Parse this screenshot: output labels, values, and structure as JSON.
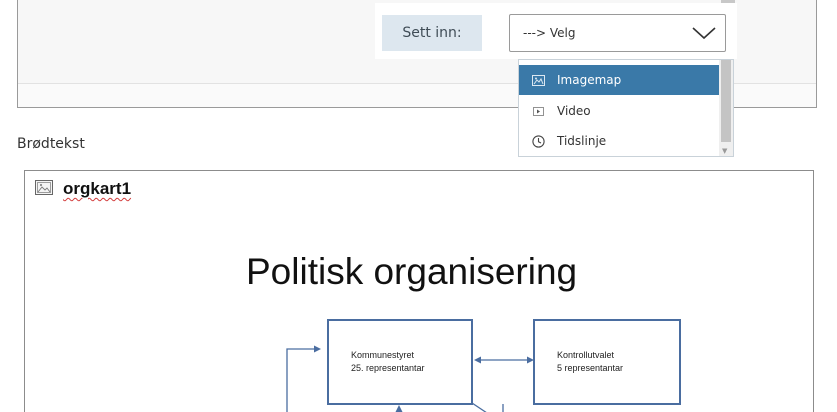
{
  "insert": {
    "label": "Sett inn:",
    "select_value": "---> Velg"
  },
  "dropdown": {
    "items": [
      {
        "label": "Imagemap",
        "icon": "image-icon",
        "selected": true
      },
      {
        "label": "Video",
        "icon": "video-icon",
        "selected": false
      },
      {
        "label": "Tidslinje",
        "icon": "clock-icon",
        "selected": false
      }
    ]
  },
  "body_section": {
    "label": "Brødtekst",
    "image_title": "orgkart1"
  },
  "slide": {
    "title": "Politisk organisering",
    "boxes": [
      {
        "line1": "Kommunestyret",
        "line2": "25. representantar"
      },
      {
        "line1": "Kontrollutvalet",
        "line2": "5 representantar"
      }
    ]
  },
  "colors": {
    "selected_item_bg": "#3a79a8",
    "insert_label_bg": "#dde7ef",
    "org_box_border": "#4a6da0"
  }
}
